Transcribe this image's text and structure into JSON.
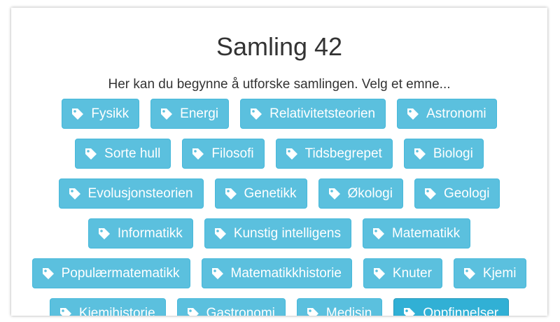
{
  "page": {
    "title": "Samling 42",
    "intro": "Her kan du begynne å utforske samlingen. Velg et emne..."
  },
  "colors": {
    "tag_background": "#5bc0de",
    "tag_active_background": "#31b0d5",
    "tag_text": "#ffffff",
    "heading_text": "#333333"
  },
  "tags": {
    "row1": [
      "Fysikk",
      "Energi",
      "Relativitetsteorien",
      "Astronomi"
    ],
    "row2": [
      "Sorte hull",
      "Filosofi",
      "Tidsbegrepet",
      "Biologi"
    ],
    "row3": [
      "Evolusjonsteorien",
      "Genetikk",
      "Økologi",
      "Geologi"
    ],
    "row4": [
      "Informatikk",
      "Kunstig intelligens",
      "Matematikk"
    ],
    "row5": [
      "Populærmatematikk",
      "Matematikkhistorie",
      "Knuter",
      "Kjemi"
    ],
    "row6": [
      "Kjemihistorie",
      "Gastronomi",
      "Medisin",
      "Oppfinnelser"
    ]
  },
  "icon": "tag-icon"
}
